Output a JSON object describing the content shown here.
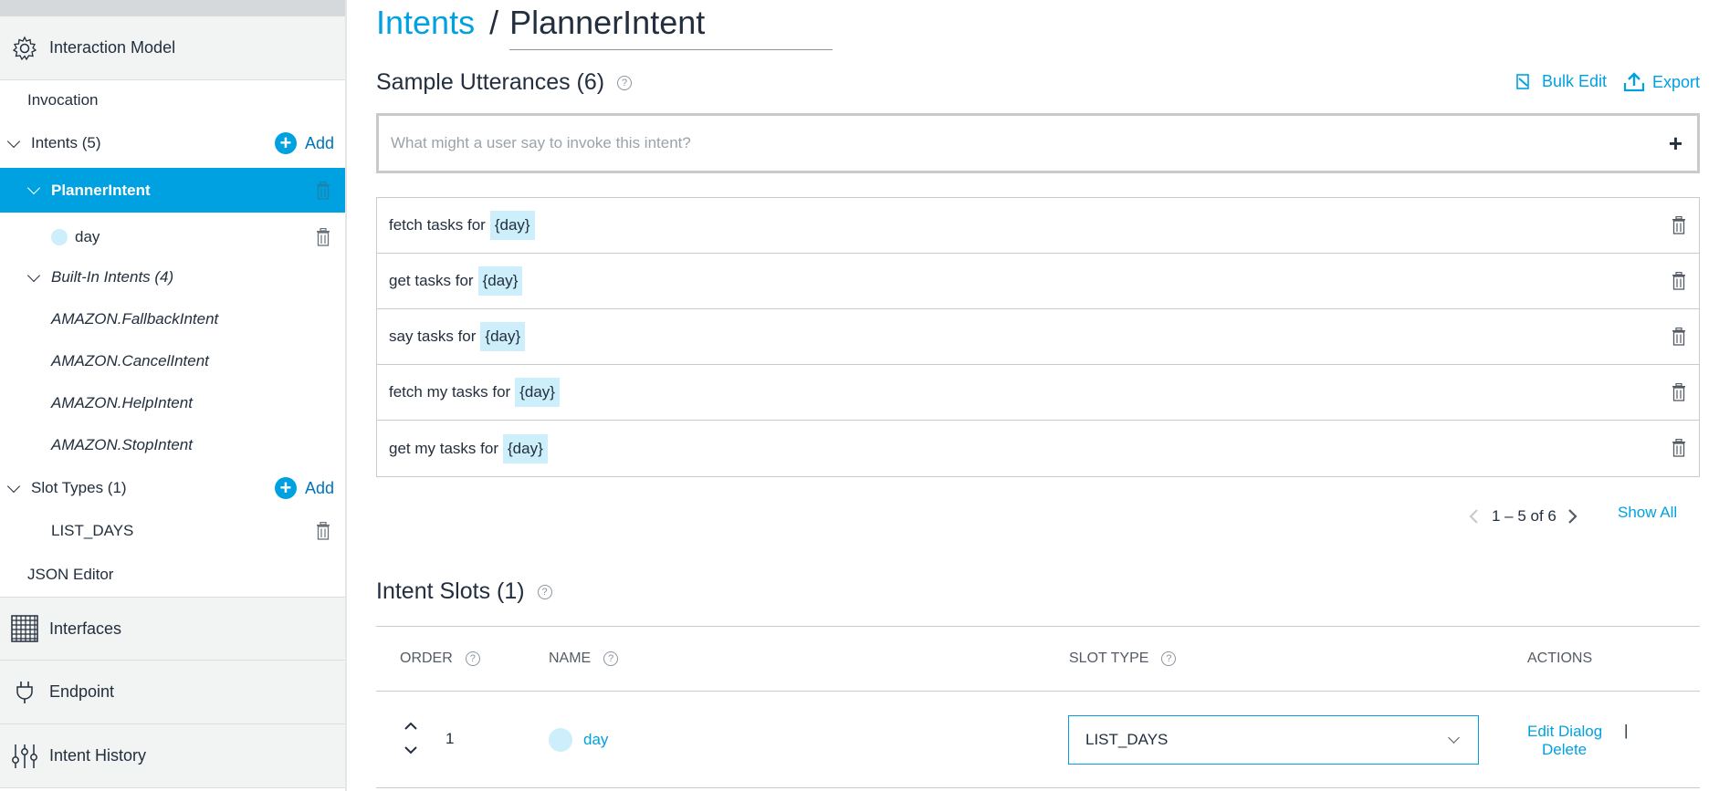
{
  "sidebar": {
    "interaction_model": "Interaction Model",
    "invocation": "Invocation",
    "intents_label": "Intents (5)",
    "add_label": "Add",
    "active_intent": "PlannerIntent",
    "slot_item": "day",
    "builtin_label": "Built-In Intents (4)",
    "builtin_items": [
      "AMAZON.FallbackIntent",
      "AMAZON.CancelIntent",
      "AMAZON.HelpIntent",
      "AMAZON.StopIntent"
    ],
    "slot_types_label": "Slot Types (1)",
    "slot_type_item": "LIST_DAYS",
    "json_editor": "JSON Editor",
    "interfaces": "Interfaces",
    "endpoint": "Endpoint",
    "intent_history": "Intent History"
  },
  "main": {
    "breadcrumb_link": "Intents",
    "breadcrumb_sep": "/",
    "intent_name": "PlannerIntent",
    "utterances_title": "Sample Utterances (6)",
    "bulk_edit": "Bulk Edit",
    "export": "Export",
    "utterance_placeholder": "What might a user say to invoke this intent?",
    "utterances": [
      {
        "text": "fetch tasks for",
        "slot": "{day}"
      },
      {
        "text": "get tasks for",
        "slot": "{day}"
      },
      {
        "text": "say tasks for",
        "slot": "{day}"
      },
      {
        "text": "fetch my tasks for",
        "slot": "{day}"
      },
      {
        "text": "get my tasks for",
        "slot": "{day}"
      }
    ],
    "pager_text": "1 – 5 of 6",
    "show_all": "Show All",
    "slots_title": "Intent Slots (1)",
    "columns": {
      "order": "ORDER",
      "name": "NAME",
      "slot_type": "SLOT TYPE",
      "actions": "ACTIONS"
    },
    "slot_row": {
      "order": "1",
      "name": "day",
      "slot_type": "LIST_DAYS",
      "edit_dialog": "Edit Dialog",
      "divider": "|",
      "delete": "Delete"
    }
  },
  "colors": {
    "accent": "#00a1e0",
    "slot_highlight": "#cdeefb",
    "sidebar_section": "#f2f3f3"
  }
}
